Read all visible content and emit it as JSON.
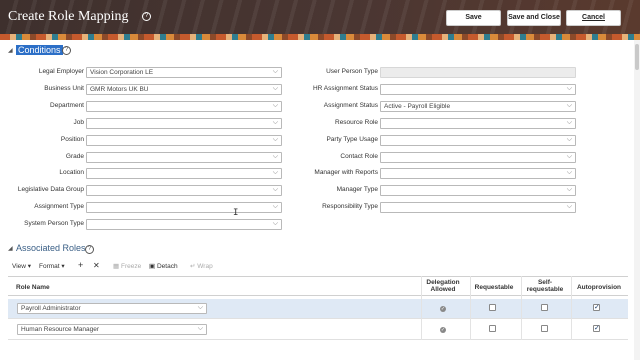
{
  "header": {
    "title": "Create Role Mapping",
    "help_glyph": "?",
    "save_label": "Save",
    "save_close_label": "Save and Close",
    "cancel_label": "Cancel"
  },
  "conditions": {
    "title": "Conditions",
    "help_glyph": "?",
    "left_fields": [
      {
        "label": "Legal Employer",
        "value": "Vision Corporation LE"
      },
      {
        "label": "Business Unit",
        "value": "GMR Motors UK BU"
      },
      {
        "label": "Department",
        "value": ""
      },
      {
        "label": "Job",
        "value": ""
      },
      {
        "label": "Position",
        "value": ""
      },
      {
        "label": "Grade",
        "value": ""
      },
      {
        "label": "Location",
        "value": ""
      },
      {
        "label": "Legislative Data Group",
        "value": ""
      },
      {
        "label": "Assignment Type",
        "value": ""
      },
      {
        "label": "System Person Type",
        "value": ""
      }
    ],
    "right_fields": [
      {
        "label": "User Person Type",
        "value": ""
      },
      {
        "label": "HR Assignment Status",
        "value": ""
      },
      {
        "label": "Assignment Status",
        "value": "Active - Payroll Eligible"
      },
      {
        "label": "Resource Role",
        "value": ""
      },
      {
        "label": "Party Type Usage",
        "value": ""
      },
      {
        "label": "Contact Role",
        "value": ""
      },
      {
        "label": "Manager with Reports",
        "value": ""
      },
      {
        "label": "Manager Type",
        "value": ""
      },
      {
        "label": "Responsibility Type",
        "value": ""
      }
    ]
  },
  "roles": {
    "title": "Associated Roles",
    "help_glyph": "?",
    "toolbar": {
      "view": "View",
      "format": "Format",
      "add_glyph": "+",
      "delete_glyph": "✕",
      "freeze": "Freeze",
      "detach": "Detach",
      "wrap": "Wrap"
    },
    "columns": {
      "role_name": "Role Name",
      "delegation": "Delegation Allowed",
      "requestable": "Requestable",
      "self_requestable": "Self-requestable",
      "autoprovision": "Autoprovision"
    },
    "rows": [
      {
        "role": "Payroll Administrator",
        "delegation": true,
        "requestable": false,
        "self_requestable": false,
        "autoprovision": true
      },
      {
        "role": "Human Resource Manager",
        "delegation": true,
        "requestable": false,
        "self_requestable": false,
        "autoprovision": true
      }
    ]
  },
  "glyphs": {
    "chevron": "⌵",
    "check": "✓",
    "expand": "◢",
    "collapse": "◢"
  }
}
